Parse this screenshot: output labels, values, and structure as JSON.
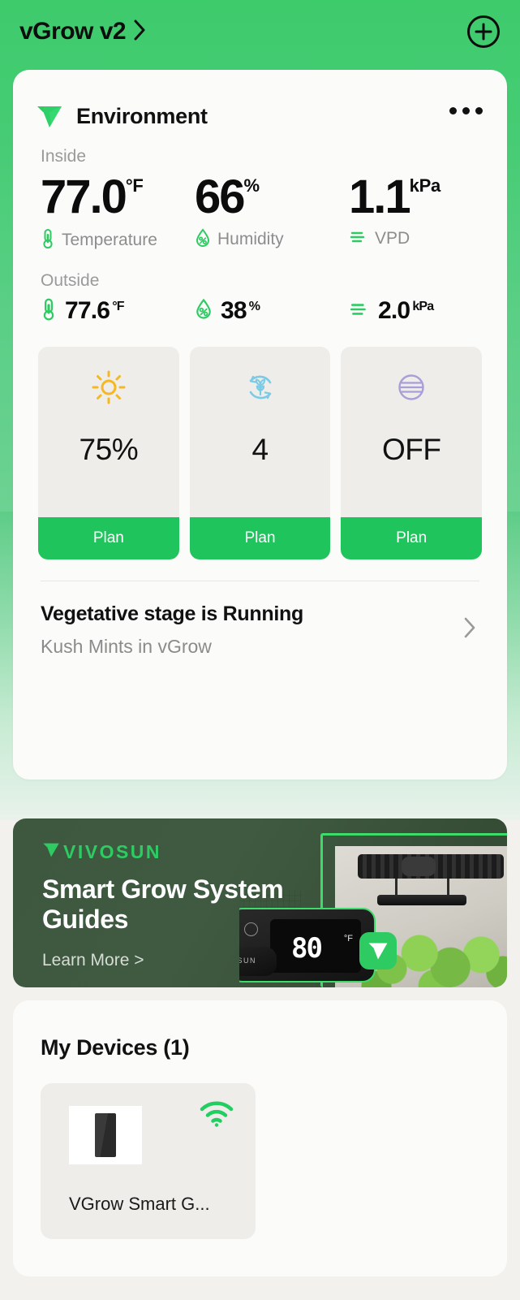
{
  "header": {
    "title": "vGrow v2",
    "chevron_icon": "chevron-right-icon",
    "add_icon": "plus-circle-icon"
  },
  "environment": {
    "logo_icon": "vivosun-v-logo",
    "title": "Environment",
    "more_icon": "more-options-icon",
    "inside_label": "Inside",
    "inside": [
      {
        "value": "77.0",
        "unit": "°F",
        "label": "Temperature",
        "icon": "thermometer-icon",
        "color": "#2ecb63"
      },
      {
        "value": "66",
        "unit": "%",
        "label": "Humidity",
        "icon": "humidity-droplet-icon",
        "color": "#2ecb63"
      },
      {
        "value": "1.1",
        "unit": "kPa",
        "label": "VPD",
        "icon": "vpd-waves-icon",
        "color": "#2ecb63"
      }
    ],
    "outside_label": "Outside",
    "outside": [
      {
        "value": "77.6",
        "unit": "°F",
        "icon": "thermometer-icon"
      },
      {
        "value": "38",
        "unit": "%",
        "icon": "humidity-droplet-icon"
      },
      {
        "value": "2.0",
        "unit": "kPa",
        "icon": "vpd-waves-icon"
      }
    ],
    "tiles": [
      {
        "icon": "sun-light-icon",
        "icon_color": "#f5b722",
        "value": "75%",
        "plan_label": "Plan"
      },
      {
        "icon": "circulation-leaf-icon",
        "icon_color": "#7ccbe6",
        "value": "4",
        "plan_label": "Plan"
      },
      {
        "icon": "heater-lines-circle-icon",
        "icon_color": "#a99fd8",
        "value": "OFF",
        "plan_label": "Plan"
      }
    ],
    "stage": {
      "title": "Vegetative stage is Running",
      "subtitle": "Kush Mints in vGrow",
      "chevron_icon": "chevron-right-icon"
    }
  },
  "banner": {
    "brand": "VIVOSUN",
    "brand_logo_icon": "vivosun-v-logo",
    "headline": "Smart Grow System Guides",
    "cta": "Learn More >",
    "device_display_value": "80",
    "device_display_unit": "°F",
    "plug_brand": "VIVOSUN",
    "badge_icon": "vivosun-badge-icon",
    "bg_color": "#3e5840",
    "accent_color": "#2ecb63"
  },
  "devices": {
    "title": "My Devices (1)",
    "items": [
      {
        "name": "VGrow Smart G...",
        "wifi_icon": "wifi-icon",
        "wifi_color": "#20cf5f",
        "thumb_icon": "grow-box-icon"
      }
    ]
  },
  "colors": {
    "brand_green": "#2ecb63",
    "header_green": "#3ecb6c",
    "plan_green": "#1fc45c",
    "card_bg": "#fbfbfa",
    "tile_bg": "#eeedea",
    "page_bg": "#f2f1ee"
  }
}
